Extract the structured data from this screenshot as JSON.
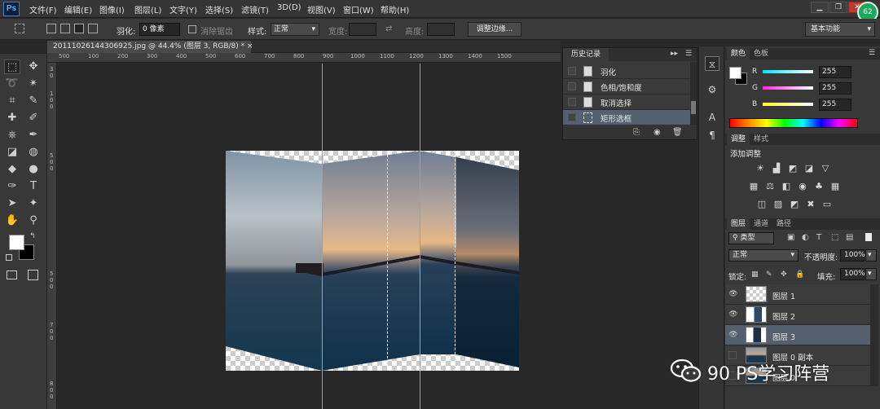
{
  "app": {
    "logo": "Ps",
    "badge": "62"
  },
  "menu": [
    "文件(F)",
    "编辑(E)",
    "图像(I)",
    "图层(L)",
    "文字(Y)",
    "选择(S)",
    "滤镜(T)",
    "3D(D)",
    "视图(V)",
    "窗口(W)",
    "帮助(H)"
  ],
  "window_controls": {
    "minimize": "▁",
    "restore": "❐",
    "close": "✕"
  },
  "options": {
    "feather_label": "羽化:",
    "feather_value": "0 像素",
    "antialias_label": "消除锯齿",
    "style_label": "样式:",
    "style_value": "正常",
    "width_label": "宽度:",
    "height_label": "高度:",
    "refine_edge": "调整边缘...",
    "workspace": "基本功能"
  },
  "document_tab": "20111026144306925.jpg @ 44.4% (图层 3, RGB/8) * ×",
  "ruler_h": [
    "500",
    "100",
    "200",
    "300",
    "400",
    "500",
    "600",
    "700",
    "800",
    "900",
    "1000",
    "1100",
    "1200",
    "1300",
    "1400",
    "1500"
  ],
  "ruler_v": [
    "3",
    "0",
    "1",
    "0",
    "0",
    "5",
    "0",
    "0",
    "5",
    "0",
    "0",
    "7",
    "0",
    "0",
    "8",
    "0",
    "0"
  ],
  "history": {
    "tab": "历史记录",
    "items": [
      {
        "label": "羽化",
        "selected": false
      },
      {
        "label": "色相/饱和度",
        "selected": false
      },
      {
        "label": "取消选择",
        "selected": false
      },
      {
        "label": "矩形选框",
        "selected": true
      }
    ]
  },
  "color_panel": {
    "tabs": [
      "颜色",
      "色板"
    ],
    "channels": [
      {
        "label": "R",
        "value": "255",
        "color": "#00e5ff"
      },
      {
        "label": "G",
        "value": "255",
        "color": "#ff2bd6"
      },
      {
        "label": "B",
        "value": "255",
        "color": "#ffff33"
      }
    ]
  },
  "adjustments_panel": {
    "tabs": [
      "调整",
      "样式"
    ],
    "title": "添加调整"
  },
  "layers_panel": {
    "tabs": [
      "图层",
      "通道",
      "路径"
    ],
    "filter_label": "类型",
    "blend_mode": "正常",
    "opacity_label": "不透明度:",
    "opacity_value": "100%",
    "lock_label": "锁定:",
    "fill_label": "填充:",
    "fill_value": "100%",
    "layers": [
      {
        "name": "图层 1",
        "visible": true,
        "selected": false
      },
      {
        "name": "图层 2",
        "visible": true,
        "selected": false
      },
      {
        "name": "图层 3",
        "visible": true,
        "selected": true
      },
      {
        "name": "图层 0 副本",
        "visible": false,
        "selected": false
      },
      {
        "name": "图层 0",
        "visible": false,
        "selected": false
      }
    ]
  },
  "watermark": "90 PS学习阵营"
}
